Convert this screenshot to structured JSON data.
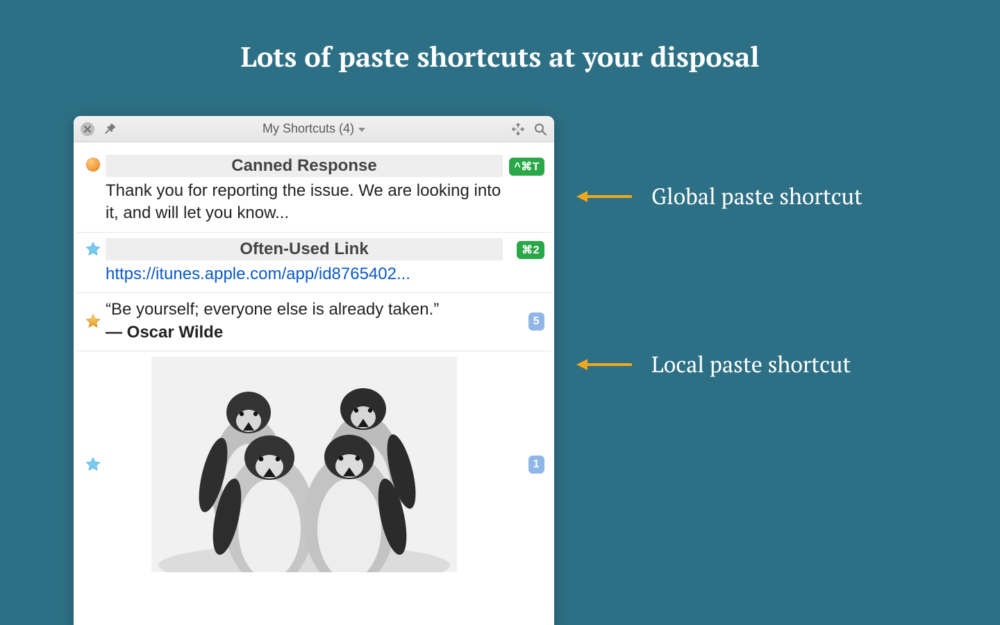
{
  "hero_title": "Lots of paste shortcuts at your disposal",
  "window": {
    "title": "My Shortcuts (4)"
  },
  "items": [
    {
      "marker": "dot",
      "heading": "Canned Response",
      "text": "Thank you for reporting the issue. We are looking into it, and will let you know...",
      "badge": {
        "kind": "green",
        "label": "^⌘T"
      }
    },
    {
      "marker": "star_blue",
      "heading": "Often-Used Link",
      "link_text": "https://itunes.apple.com/app/id8765402...",
      "badge": {
        "kind": "green",
        "label": "⌘2"
      }
    },
    {
      "marker": "star_gold",
      "quote": "“Be yourself; everyone else is already taken.”",
      "author": "― Oscar Wilde",
      "badge": {
        "kind": "blue",
        "label": "5"
      }
    },
    {
      "marker": "star_blue",
      "image": true,
      "badge": {
        "kind": "blue",
        "label": "1"
      }
    }
  ],
  "callouts": {
    "global": "Global paste shortcut",
    "local": "Local paste shortcut"
  }
}
